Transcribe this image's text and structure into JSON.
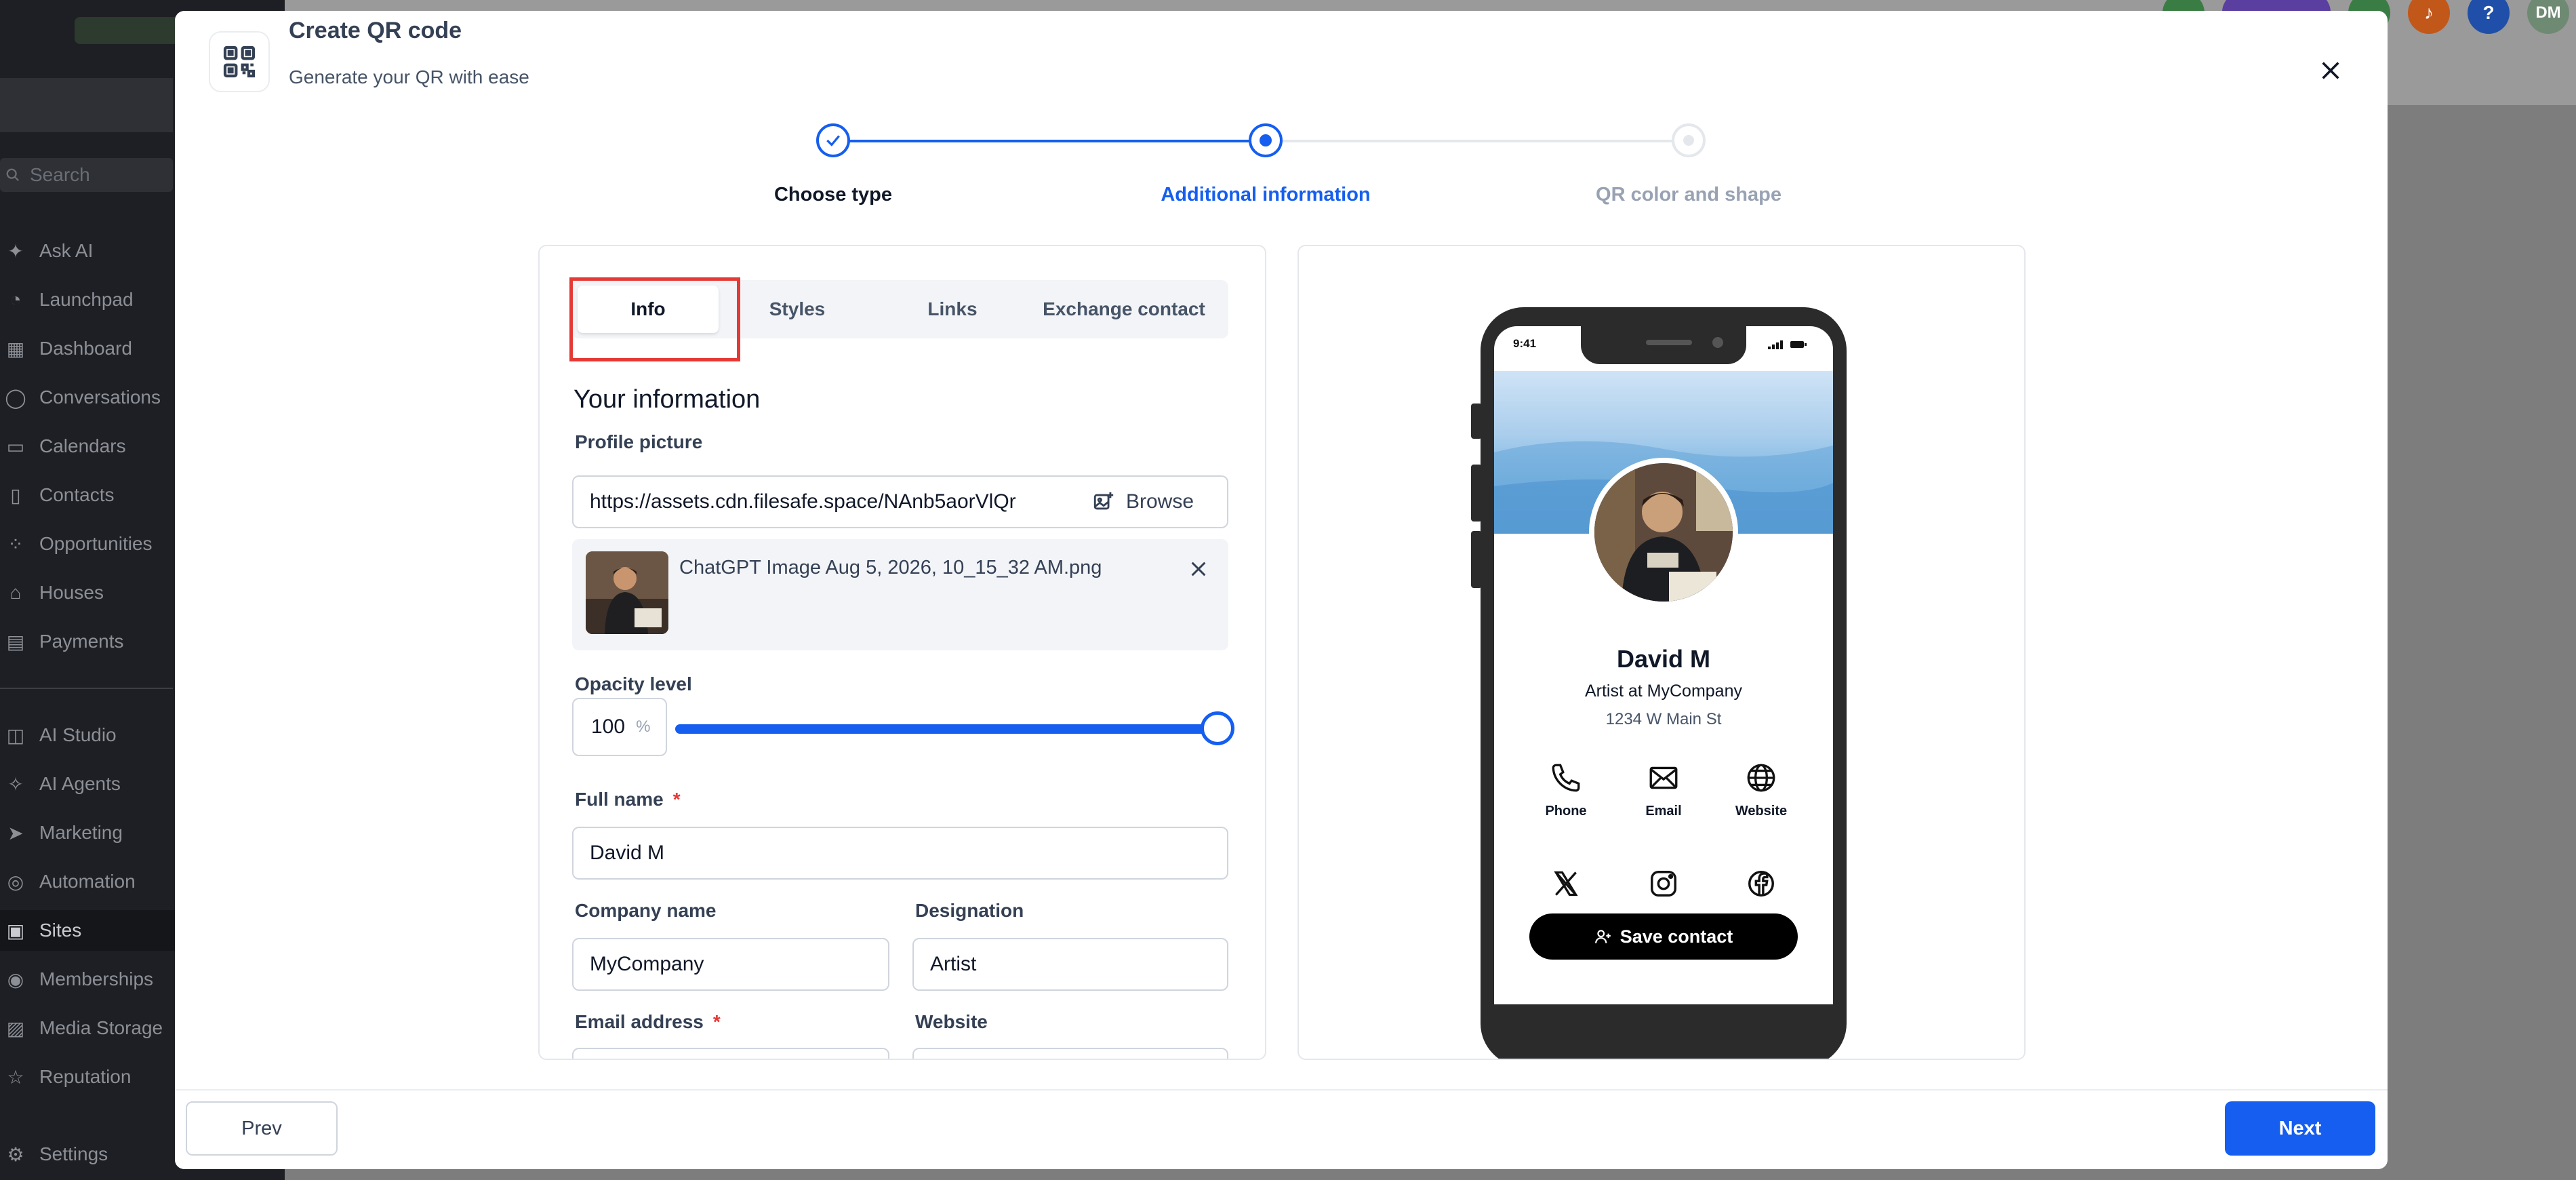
{
  "sidebar": {
    "search_placeholder": "Search",
    "items": [
      {
        "label": "Ask AI",
        "icon": "sparkle-icon"
      },
      {
        "label": "Launchpad",
        "icon": "rocket-icon"
      },
      {
        "label": "Dashboard",
        "icon": "grid-icon"
      },
      {
        "label": "Conversations",
        "icon": "chat-icon"
      },
      {
        "label": "Calendars",
        "icon": "calendar-icon"
      },
      {
        "label": "Contacts",
        "icon": "contact-icon"
      },
      {
        "label": "Opportunities",
        "icon": "pipeline-icon"
      },
      {
        "label": "Houses",
        "icon": "house-icon"
      },
      {
        "label": "Payments",
        "icon": "receipt-icon"
      },
      {
        "label": "AI Studio",
        "icon": "studio-icon"
      },
      {
        "label": "AI Agents",
        "icon": "agents-icon"
      },
      {
        "label": "Marketing",
        "icon": "send-icon"
      },
      {
        "label": "Automation",
        "icon": "automation-icon"
      },
      {
        "label": "Sites",
        "icon": "globe-icon",
        "active": true
      },
      {
        "label": "Memberships",
        "icon": "medal-icon"
      },
      {
        "label": "Media Storage",
        "icon": "image-icon"
      },
      {
        "label": "Reputation",
        "icon": "star-icon"
      },
      {
        "label": "Settings",
        "icon": "gear-icon"
      }
    ]
  },
  "topbar": {
    "avatar_initials": "DM",
    "help_label": "?"
  },
  "modal": {
    "title": "Create QR code",
    "subtitle": "Generate your QR with ease",
    "steps": [
      {
        "label": "Choose type",
        "state": "done"
      },
      {
        "label": "Additional information",
        "state": "current"
      },
      {
        "label": "QR color and shape",
        "state": "upcoming"
      }
    ],
    "tabs": [
      "Info",
      "Styles",
      "Links",
      "Exchange contact"
    ],
    "active_tab": "Info",
    "section_title": "Your information",
    "profile_picture": {
      "label": "Profile picture",
      "url": "https://assets.cdn.filesafe.space/NAnb5aorVlQr",
      "browse_label": "Browse",
      "file_name": "ChatGPT Image Aug 5, 2026, 10_15_32 AM.png"
    },
    "opacity": {
      "label": "Opacity level",
      "value": "100",
      "unit": "%",
      "level": 100
    },
    "full_name": {
      "label": "Full name",
      "required_mark": "*",
      "value": "David M"
    },
    "company_name": {
      "label": "Company name",
      "value": "MyCompany"
    },
    "designation": {
      "label": "Designation",
      "value": "Artist"
    },
    "email": {
      "label": "Email address",
      "required_mark": "*",
      "value": ""
    },
    "website": {
      "label": "Website",
      "value": ""
    },
    "prev_label": "Prev",
    "next_label": "Next"
  },
  "preview": {
    "status_time": "9:41",
    "name": "David M",
    "title_line": "Artist at MyCompany",
    "address": "1234 W Main St",
    "actions": [
      {
        "label": "Phone",
        "icon": "phone-icon"
      },
      {
        "label": "Email",
        "icon": "mail-icon"
      },
      {
        "label": "Website",
        "icon": "globe-icon"
      }
    ],
    "social": [
      "x-icon",
      "instagram-icon",
      "facebook-icon"
    ],
    "save_label": "Save contact"
  },
  "colors": {
    "accent": "#155eef",
    "highlight": "#e53935",
    "sidebar_bg": "#1e1f24"
  }
}
